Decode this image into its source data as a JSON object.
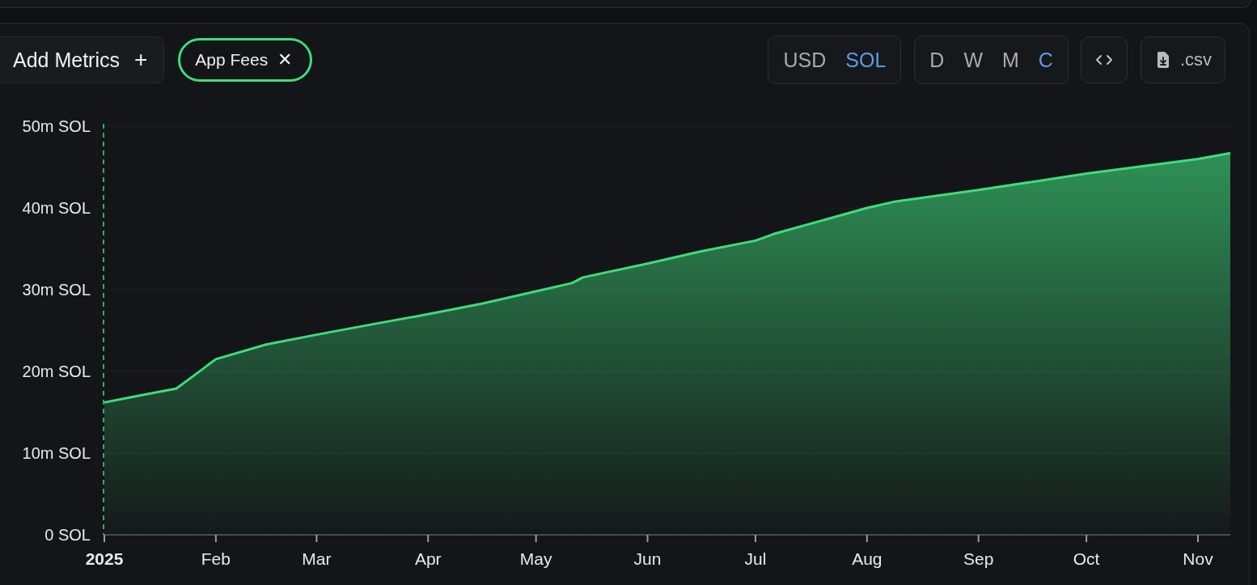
{
  "toolbar": {
    "add_button": {
      "label": "Add Metrics",
      "icon": "+"
    },
    "chip_icon": "✕",
    "currency": [
      {
        "label": "USD",
        "selected": false
      },
      {
        "label": "SOL",
        "selected": true
      }
    ],
    "period": [
      {
        "label": "D",
        "selected": false
      },
      {
        "label": "W",
        "selected": false
      },
      {
        "label": "M",
        "selected": false
      },
      {
        "label": "C",
        "selected": true
      }
    ],
    "csv_button": {
      "label": ".csv"
    }
  },
  "chart_data": {
    "type": "area",
    "x": [
      "2025-01-01",
      "2025-01-08",
      "2025-01-15",
      "2025-01-21",
      "2025-01-25",
      "2025-02-01",
      "2025-02-15",
      "2025-03-01",
      "2025-03-17",
      "2025-04-01",
      "2025-04-16",
      "2025-05-01",
      "2025-05-11",
      "2025-05-14",
      "2025-06-01",
      "2025-06-16",
      "2025-07-01",
      "2025-07-06",
      "2025-08-01",
      "2025-08-09",
      "2025-09-01",
      "2025-10-01",
      "2025-11-01",
      "2025-11-10"
    ],
    "series": [
      {
        "name": "App Fees",
        "color": "#3fdc7c",
        "values": [
          16.2,
          16.8,
          17.4,
          17.9,
          19.2,
          21.5,
          23.3,
          24.5,
          25.8,
          27,
          28.3,
          29.8,
          30.8,
          31.5,
          33.2,
          34.7,
          36,
          36.8,
          40,
          40.8,
          42.2,
          44.2,
          46,
          46.7
        ]
      }
    ],
    "xlim": [
      "2025-01-01",
      "2025-11-10"
    ],
    "ylim": [
      0,
      50
    ],
    "grid": true,
    "xticks": [
      {
        "value": "2025-01-01",
        "label": "2025"
      },
      {
        "value": "2025-02-01",
        "label": "Feb"
      },
      {
        "value": "2025-03-01",
        "label": "Mar"
      },
      {
        "value": "2025-04-01",
        "label": "Apr"
      },
      {
        "value": "2025-05-01",
        "label": "May"
      },
      {
        "value": "2025-06-01",
        "label": "Jun"
      },
      {
        "value": "2025-07-01",
        "label": "Jul"
      },
      {
        "value": "2025-08-01",
        "label": "Aug"
      },
      {
        "value": "2025-09-01",
        "label": "Sep"
      },
      {
        "value": "2025-10-01",
        "label": "Oct"
      },
      {
        "value": "2025-11-01",
        "label": "Nov"
      }
    ],
    "yticks": [
      {
        "value": 0,
        "label": "0 SOL"
      },
      {
        "value": 10,
        "label": "10m SOL"
      },
      {
        "value": 20,
        "label": "20m SOL"
      },
      {
        "value": 30,
        "label": "30m SOL"
      },
      {
        "value": 40,
        "label": "40m SOL"
      },
      {
        "value": 50,
        "label": "50m SOL"
      }
    ]
  }
}
